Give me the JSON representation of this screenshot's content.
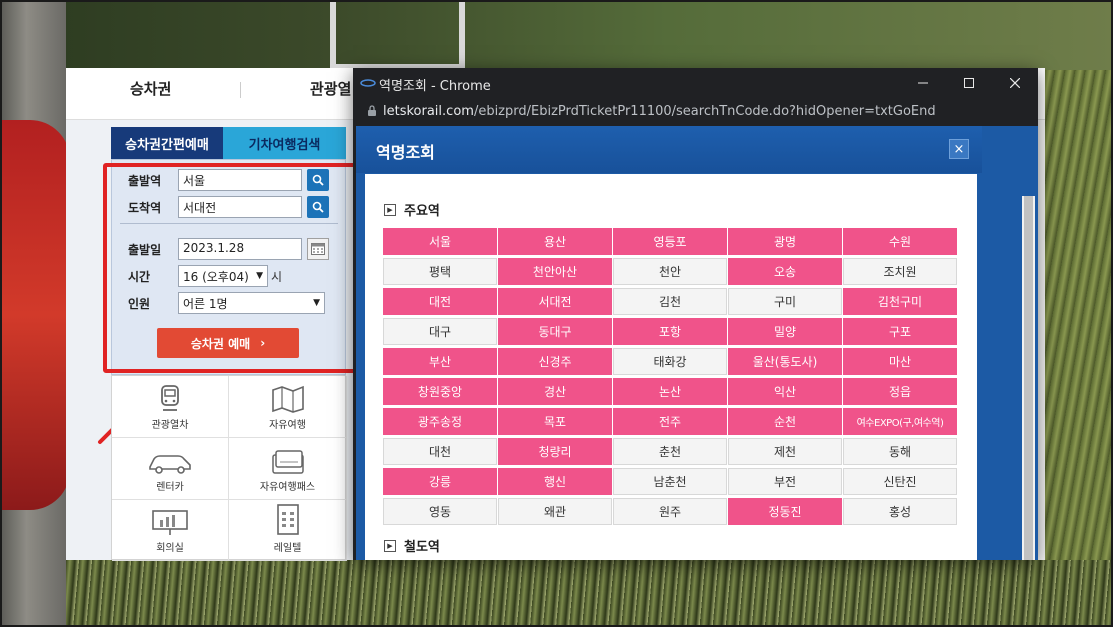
{
  "korail": {
    "nav": [
      "승차권",
      "관광열"
    ],
    "tabs": [
      "승차권간편예매",
      "기차여행검색"
    ],
    "form": {
      "depart_label": "출발역",
      "depart_value": "서울",
      "arrive_label": "도착역",
      "arrive_value": "서대전",
      "date_label": "출발일",
      "date_value": "2023.1.28",
      "time_label": "시간",
      "time_value": "16 (오후04)",
      "time_unit": "시",
      "people_label": "인원",
      "people_value": "어른 1명",
      "book_button": "승차권 예매"
    },
    "quick_menu": [
      "관광열차",
      "자유여행",
      "렌터카",
      "자유여행패스",
      "회의실",
      "레일텔"
    ],
    "quick_icons": [
      "train-icon",
      "map-icon",
      "car-icon",
      "pass-card-icon",
      "presentation-icon",
      "hotel-icon"
    ]
  },
  "popup": {
    "window_title": "역명조회 - Chrome",
    "url_domain": "letskorail.com",
    "url_path": "/ebizprd/EbizPrdTicketPr11100/searchTnCode.do?hidOpener=txtGoEnd",
    "header_title": "역명조회",
    "close_label": "×",
    "section_major": "주요역",
    "section_rail": "철도역",
    "stations": [
      {
        "name": "서울",
        "highlight": true
      },
      {
        "name": "용산",
        "highlight": true
      },
      {
        "name": "영등포",
        "highlight": true
      },
      {
        "name": "광명",
        "highlight": true
      },
      {
        "name": "수원",
        "highlight": true
      },
      {
        "name": "평택",
        "highlight": false
      },
      {
        "name": "천안아산",
        "highlight": true
      },
      {
        "name": "천안",
        "highlight": false
      },
      {
        "name": "오송",
        "highlight": true
      },
      {
        "name": "조치원",
        "highlight": false
      },
      {
        "name": "대전",
        "highlight": true
      },
      {
        "name": "서대전",
        "highlight": true
      },
      {
        "name": "김천",
        "highlight": false
      },
      {
        "name": "구미",
        "highlight": false
      },
      {
        "name": "김천구미",
        "highlight": true
      },
      {
        "name": "대구",
        "highlight": false
      },
      {
        "name": "동대구",
        "highlight": true
      },
      {
        "name": "포항",
        "highlight": true
      },
      {
        "name": "밀양",
        "highlight": true
      },
      {
        "name": "구포",
        "highlight": true
      },
      {
        "name": "부산",
        "highlight": true
      },
      {
        "name": "신경주",
        "highlight": true
      },
      {
        "name": "태화강",
        "highlight": false
      },
      {
        "name": "울산(통도사)",
        "highlight": true
      },
      {
        "name": "마산",
        "highlight": true
      },
      {
        "name": "창원중앙",
        "highlight": true
      },
      {
        "name": "경산",
        "highlight": true
      },
      {
        "name": "논산",
        "highlight": true
      },
      {
        "name": "익산",
        "highlight": true
      },
      {
        "name": "정읍",
        "highlight": true
      },
      {
        "name": "광주송정",
        "highlight": true
      },
      {
        "name": "목포",
        "highlight": true
      },
      {
        "name": "전주",
        "highlight": true
      },
      {
        "name": "순천",
        "highlight": true
      },
      {
        "name": "여수EXPO(구,여수역)",
        "highlight": true
      },
      {
        "name": "대천",
        "highlight": false
      },
      {
        "name": "청량리",
        "highlight": true
      },
      {
        "name": "춘천",
        "highlight": false
      },
      {
        "name": "제천",
        "highlight": false
      },
      {
        "name": "동해",
        "highlight": false
      },
      {
        "name": "강릉",
        "highlight": true
      },
      {
        "name": "행신",
        "highlight": true
      },
      {
        "name": "남춘천",
        "highlight": false
      },
      {
        "name": "부전",
        "highlight": false
      },
      {
        "name": "신탄진",
        "highlight": false
      },
      {
        "name": "영동",
        "highlight": false
      },
      {
        "name": "왜관",
        "highlight": false
      },
      {
        "name": "원주",
        "highlight": false
      },
      {
        "name": "정동진",
        "highlight": true
      },
      {
        "name": "홍성",
        "highlight": false
      }
    ]
  },
  "colors": {
    "highlight_station": "#f0538a",
    "tab_active": "#173a7a",
    "tab_inactive": "#2aa6d8",
    "book_button": "#e24a34",
    "annotation_red": "#e02323",
    "popup_blue": "#1c5aa5"
  }
}
